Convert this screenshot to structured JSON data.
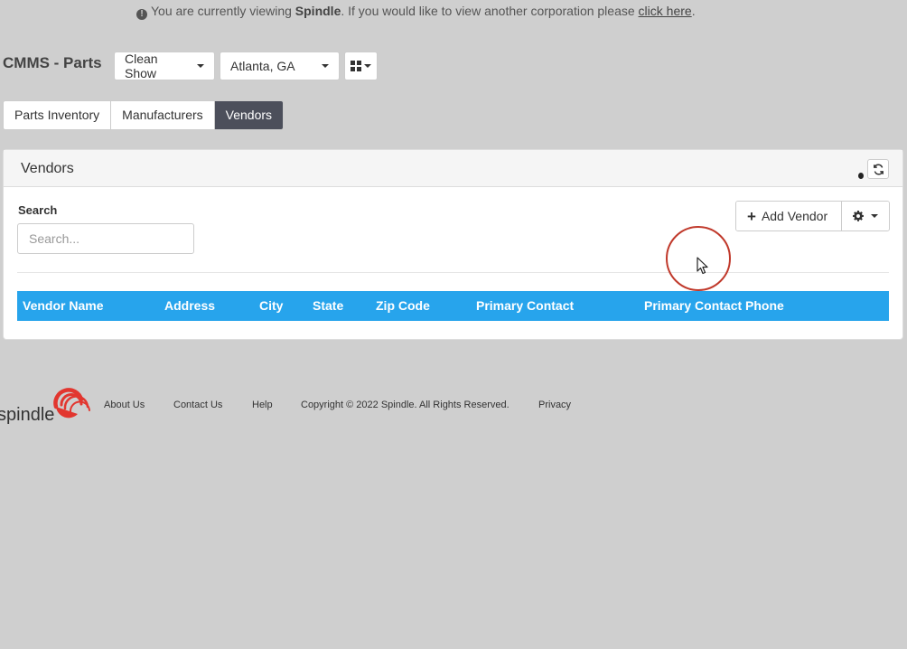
{
  "notice": {
    "prefix": "You are currently viewing",
    "corp": "Spindle",
    "middle": ". If you would like to view another corporation please",
    "link": "click here",
    "suffix": "."
  },
  "header": {
    "title": "CMMS - Parts",
    "corp_dropdown": "Clean Show",
    "location_dropdown": "Atlanta, GA"
  },
  "tabs": [
    {
      "label": "Parts Inventory",
      "active": false
    },
    {
      "label": "Manufacturers",
      "active": false
    },
    {
      "label": "Vendors",
      "active": true
    }
  ],
  "panel": {
    "title": "Vendors",
    "search_label": "Search",
    "search_placeholder": "Search...",
    "search_value": "",
    "add_button": "Add Vendor",
    "columns": [
      "Vendor Name",
      "Address",
      "City",
      "State",
      "Zip Code",
      "Primary Contact",
      "Primary Contact Phone"
    ],
    "rows": []
  },
  "footer": {
    "logo_text": "spindle",
    "links": [
      "About Us",
      "Contact Us",
      "Help"
    ],
    "copyright": "Copyright © 2022 Spindle. All Rights Reserved.",
    "privacy": "Privacy"
  },
  "colors": {
    "page_bg": "#cfcfcf",
    "table_header": "#27a4ec",
    "active_tab": "#4c4f5b",
    "brand_red": "#e2362f",
    "cursor_ring": "#c0392b"
  },
  "icons": [
    "info-icon",
    "caret-down-icon",
    "grid-icon",
    "refresh-icon",
    "plus-icon",
    "gear-icon",
    "mouse-cursor-icon",
    "spindle-logo"
  ]
}
